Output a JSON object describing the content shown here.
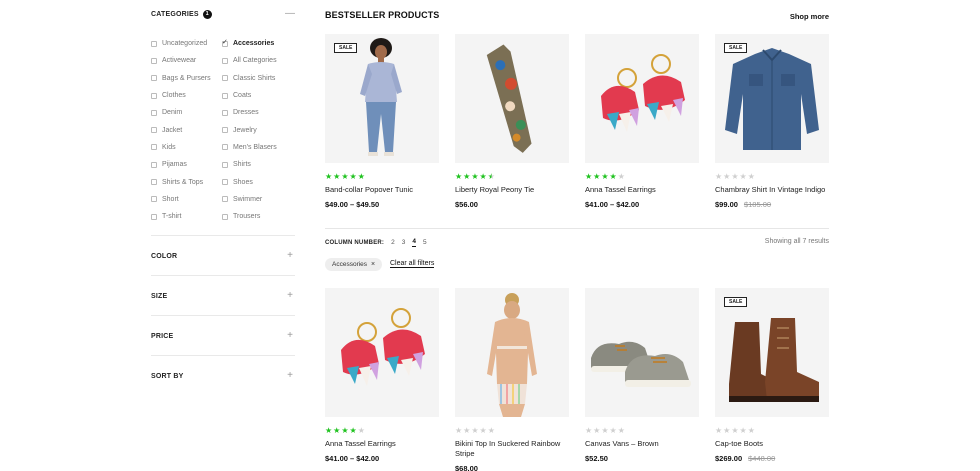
{
  "sidebar": {
    "categories": {
      "title": "CATEGORIES",
      "count": "1",
      "toggle": "—",
      "items": [
        {
          "label": "Uncategorized",
          "checked": false
        },
        {
          "label": "Accessories",
          "checked": true
        },
        {
          "label": "Activewear",
          "checked": false
        },
        {
          "label": "All Categories",
          "checked": false
        },
        {
          "label": "Bags & Pursers",
          "checked": false
        },
        {
          "label": "Classic Shirts",
          "checked": false
        },
        {
          "label": "Clothes",
          "checked": false
        },
        {
          "label": "Coats",
          "checked": false
        },
        {
          "label": "Denim",
          "checked": false
        },
        {
          "label": "Dresses",
          "checked": false
        },
        {
          "label": "Jacket",
          "checked": false
        },
        {
          "label": "Jewelry",
          "checked": false
        },
        {
          "label": "Kids",
          "checked": false
        },
        {
          "label": "Men's Blasers",
          "checked": false
        },
        {
          "label": "Pijamas",
          "checked": false
        },
        {
          "label": "Shirts",
          "checked": false
        },
        {
          "label": "Shirts & Tops",
          "checked": false
        },
        {
          "label": "Shoes",
          "checked": false
        },
        {
          "label": "Short",
          "checked": false
        },
        {
          "label": "Swimmer",
          "checked": false
        },
        {
          "label": "T-shirt",
          "checked": false
        },
        {
          "label": "Trousers",
          "checked": false
        }
      ]
    },
    "filters": [
      {
        "title": "COLOR",
        "toggle": "+"
      },
      {
        "title": "SIZE",
        "toggle": "+"
      },
      {
        "title": "PRICE",
        "toggle": "+"
      },
      {
        "title": "SORT BY",
        "toggle": "+"
      }
    ]
  },
  "bestseller": {
    "title": "BESTSELLER PRODUCTS",
    "shop_more": "Shop more",
    "products": [
      {
        "name": "Band-collar Popover Tunic",
        "price": "$49.00 – $49.50",
        "old_price": "",
        "rating": 5,
        "sale": "SALE",
        "image": "tunic-woman"
      },
      {
        "name": "Liberty Royal Peony Tie",
        "price": "$56.00",
        "old_price": "",
        "rating": 4.5,
        "sale": "",
        "image": "floral-tie"
      },
      {
        "name": "Anna Tassel Earrings",
        "price": "$41.00 – $42.00",
        "old_price": "",
        "rating": 4,
        "sale": "",
        "image": "tassel-earrings"
      },
      {
        "name": "Chambray Shirt In Vintage Indigo",
        "price": "$99.00",
        "old_price": "$185.00",
        "rating": 0,
        "sale": "SALE",
        "image": "denim-shirt"
      }
    ]
  },
  "toolbar": {
    "column_label": "COLUMN NUMBER:",
    "columns": [
      "2",
      "3",
      "4",
      "5"
    ],
    "active_column": "4",
    "showing": "Showing all 7 results",
    "chip_label": "Accessories",
    "chip_close": "×",
    "clear_all": "Clear all filters"
  },
  "results": {
    "products": [
      {
        "name": "Anna Tassel Earrings",
        "price": "$41.00 – $42.00",
        "old_price": "",
        "rating": 4,
        "sale": "",
        "image": "tassel-earrings"
      },
      {
        "name": "Bikini Top In Suckered Rainbow Stripe",
        "price": "$68.00",
        "old_price": "",
        "rating": 0,
        "sale": "",
        "image": "bikini-woman"
      },
      {
        "name": "Canvas Vans – Brown",
        "price": "$52.50",
        "old_price": "",
        "rating": 0,
        "sale": "",
        "image": "canvas-sneakers"
      },
      {
        "name": "Cap-toe Boots",
        "price": "$269.00",
        "old_price": "$448.00",
        "rating": 0,
        "sale": "SALE",
        "image": "brown-boots"
      }
    ]
  },
  "colors": {
    "star_on": "#1ec21e",
    "star_off": "#cfcfcf",
    "text_dark": "#111111",
    "text_muted": "#777777"
  }
}
